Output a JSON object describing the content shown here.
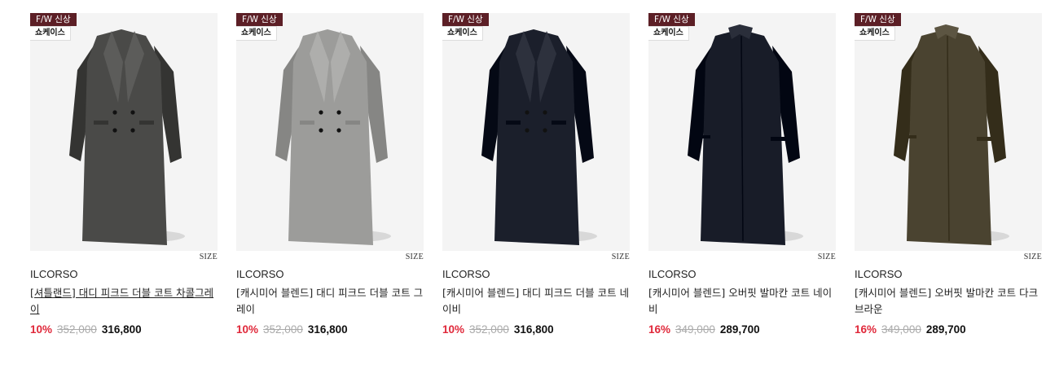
{
  "products": [
    {
      "badge_new": "F/W 신상",
      "badge_show": "쇼케이스",
      "size_label": "SIZE",
      "brand": "ILCORSO",
      "title": "[셔틀랜드] 대디 피크드 더블 코트 차콜그레이",
      "discount": "10%",
      "original_price": "352,000",
      "price": "316,800",
      "coat_color": "#4a4a48",
      "coat_style": "double-peaked",
      "title_underlined": true
    },
    {
      "badge_new": "F/W 신상",
      "badge_show": "쇼케이스",
      "size_label": "SIZE",
      "brand": "ILCORSO",
      "title": "[캐시미어 블렌드] 대디 피크드 더블 코트 그레이",
      "discount": "10%",
      "original_price": "352,000",
      "price": "316,800",
      "coat_color": "#9c9c9a",
      "coat_style": "double-peaked",
      "title_underlined": false
    },
    {
      "badge_new": "F/W 신상",
      "badge_show": "쇼케이스",
      "size_label": "SIZE",
      "brand": "ILCORSO",
      "title": "[캐시미어 블렌드] 대디 피크드 더블 코트 네이비",
      "discount": "10%",
      "original_price": "352,000",
      "price": "316,800",
      "coat_color": "#1b1f2b",
      "coat_style": "double-peaked",
      "title_underlined": false
    },
    {
      "badge_new": "F/W 신상",
      "badge_show": "쇼케이스",
      "size_label": "SIZE",
      "brand": "ILCORSO",
      "title": "[캐시미어 블렌드] 오버핏 발마칸 코트 네이비",
      "discount": "16%",
      "original_price": "349,000",
      "price": "289,700",
      "coat_color": "#181c28",
      "coat_style": "balmacaan",
      "title_underlined": false
    },
    {
      "badge_new": "F/W 신상",
      "badge_show": "쇼케이스",
      "size_label": "SIZE",
      "brand": "ILCORSO",
      "title": "[캐시미어 블렌드] 오버핏 발마칸 코트 다크브라운",
      "discount": "16%",
      "original_price": "349,000",
      "price": "289,700",
      "coat_color": "#4a4330",
      "coat_style": "balmacaan",
      "title_underlined": false
    }
  ]
}
